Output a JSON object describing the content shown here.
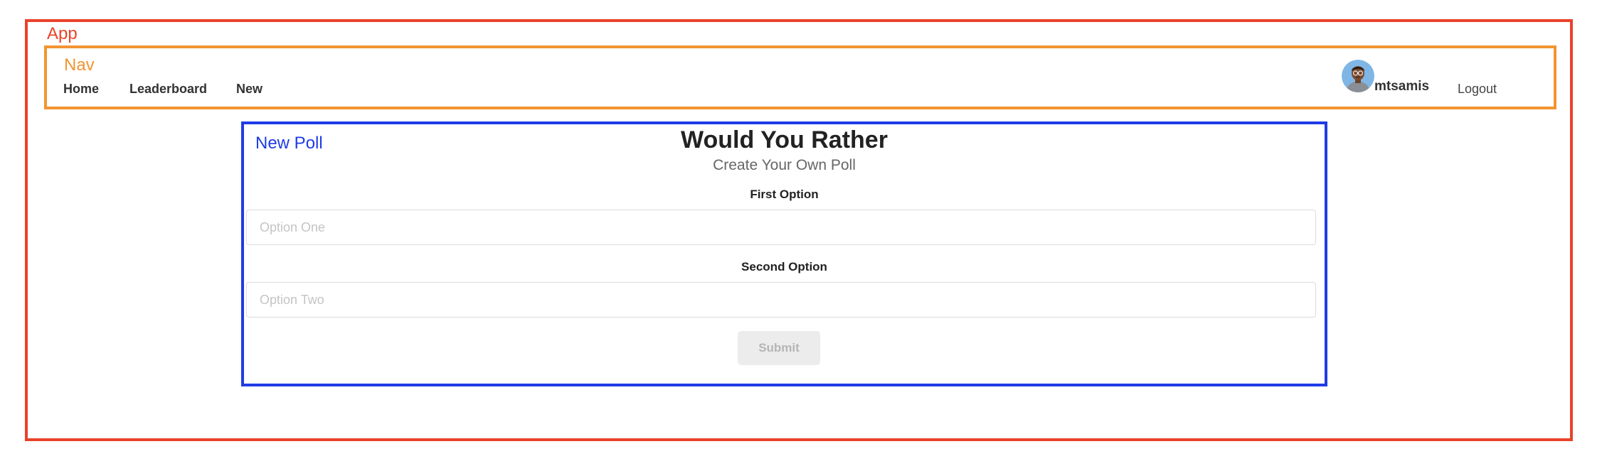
{
  "app": {
    "label": "App"
  },
  "nav": {
    "label": "Nav",
    "links": [
      {
        "label": "Home"
      },
      {
        "label": "Leaderboard"
      },
      {
        "label": "New"
      }
    ],
    "user": {
      "name": "mtsamis",
      "avatar_icon": "avatar-icon"
    },
    "logout_label": "Logout"
  },
  "new_poll": {
    "label": "New Poll",
    "title": "Would You Rather",
    "subtitle": "Create Your Own Poll",
    "first_option": {
      "label": "First Option",
      "value": "",
      "placeholder": "Option One"
    },
    "second_option": {
      "label": "Second Option",
      "value": "",
      "placeholder": "Option Two"
    },
    "submit_label": "Submit"
  },
  "colors": {
    "app_border": "#e8432a",
    "nav_border": "#f29531",
    "poll_border": "#1f3be6",
    "submit_disabled_bg": "#ececec"
  }
}
